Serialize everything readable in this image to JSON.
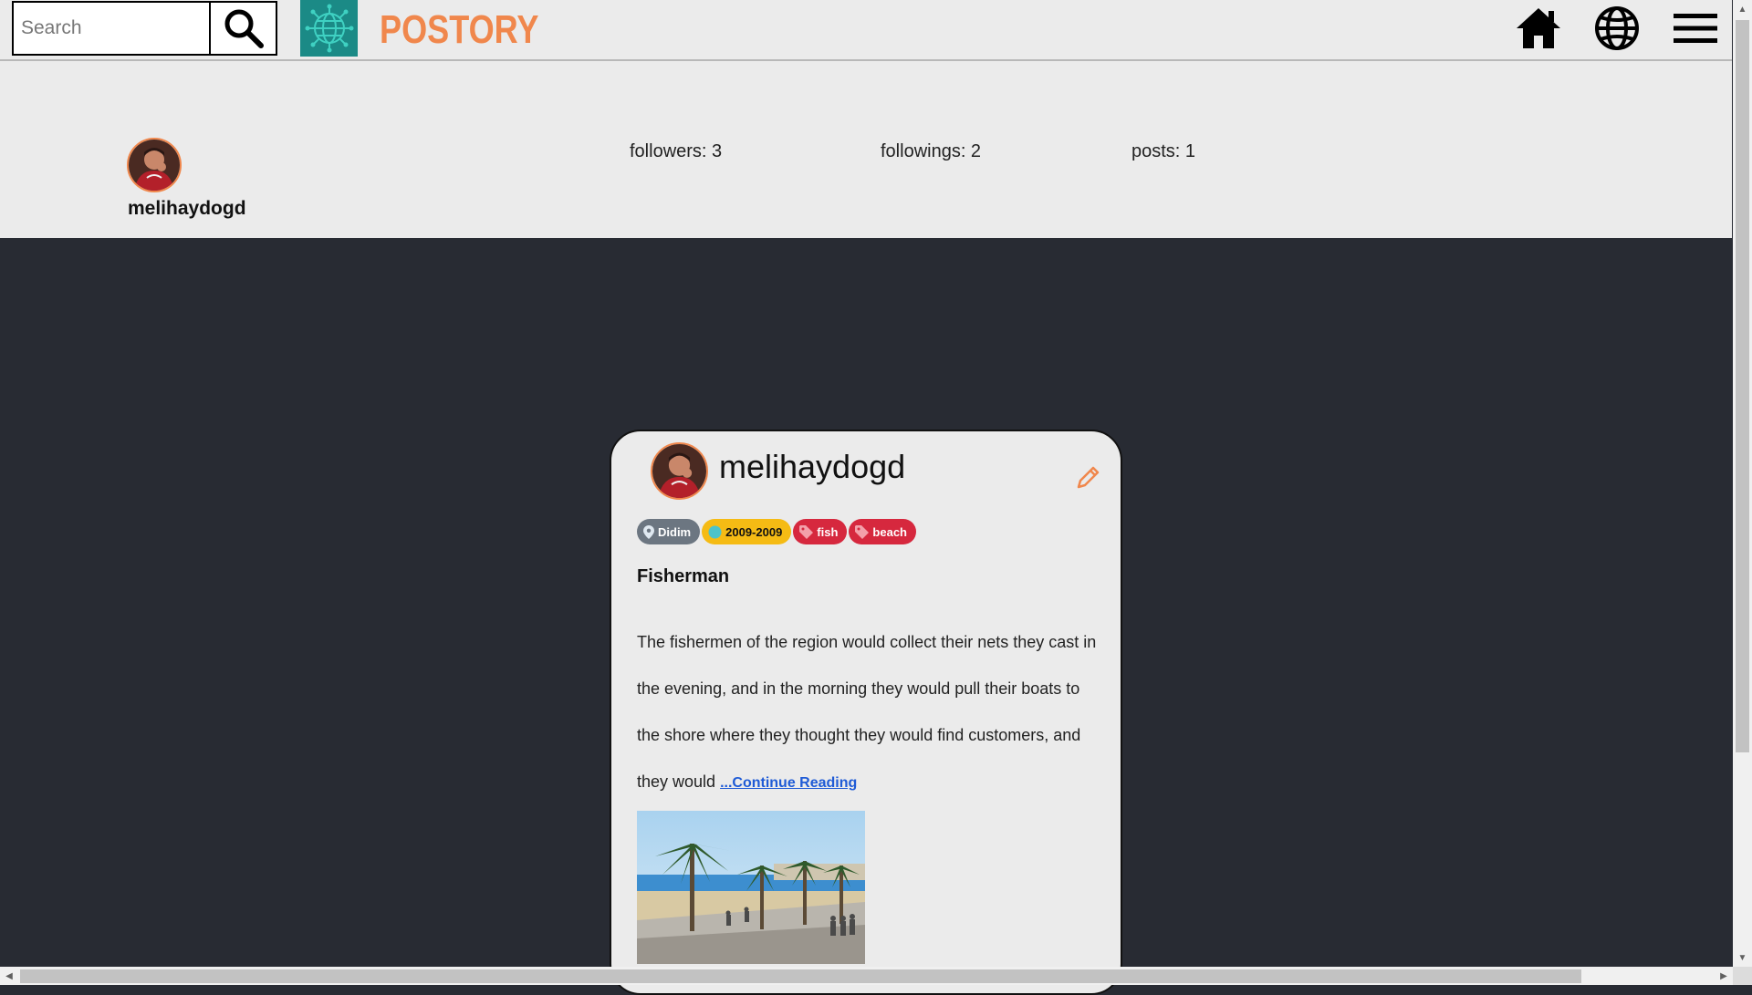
{
  "header": {
    "search_placeholder": "Search",
    "brand": "POSTORY",
    "icons": [
      "search-icon",
      "globe-logo-icon",
      "home-icon",
      "globe-icon",
      "menu-icon"
    ]
  },
  "profile": {
    "username": "melihaydogd",
    "followers": "followers: 3",
    "followings": "followings: 2",
    "posts": "posts: 1"
  },
  "post": {
    "username": "melihaydogd",
    "tags": {
      "location": "Didim",
      "date": "2009-2009",
      "tag1": "fish",
      "tag2": "beach"
    },
    "title": "Fisherman",
    "body": "The fishermen of the region would collect their nets they cast in the evening, and in the morning they would pull their boats to the shore where they thought they would find customers, and they would ",
    "continue_label": "...Continue Reading"
  },
  "colors": {
    "accent": "#f0874c",
    "logo_bg": "#1b8a86",
    "page_bg": "#282b33",
    "surface": "#ebebeb",
    "tag_location": "#6c7681",
    "tag_date": "#f5bb14",
    "tag_label": "#d6283e",
    "link": "#1f5bd6"
  }
}
